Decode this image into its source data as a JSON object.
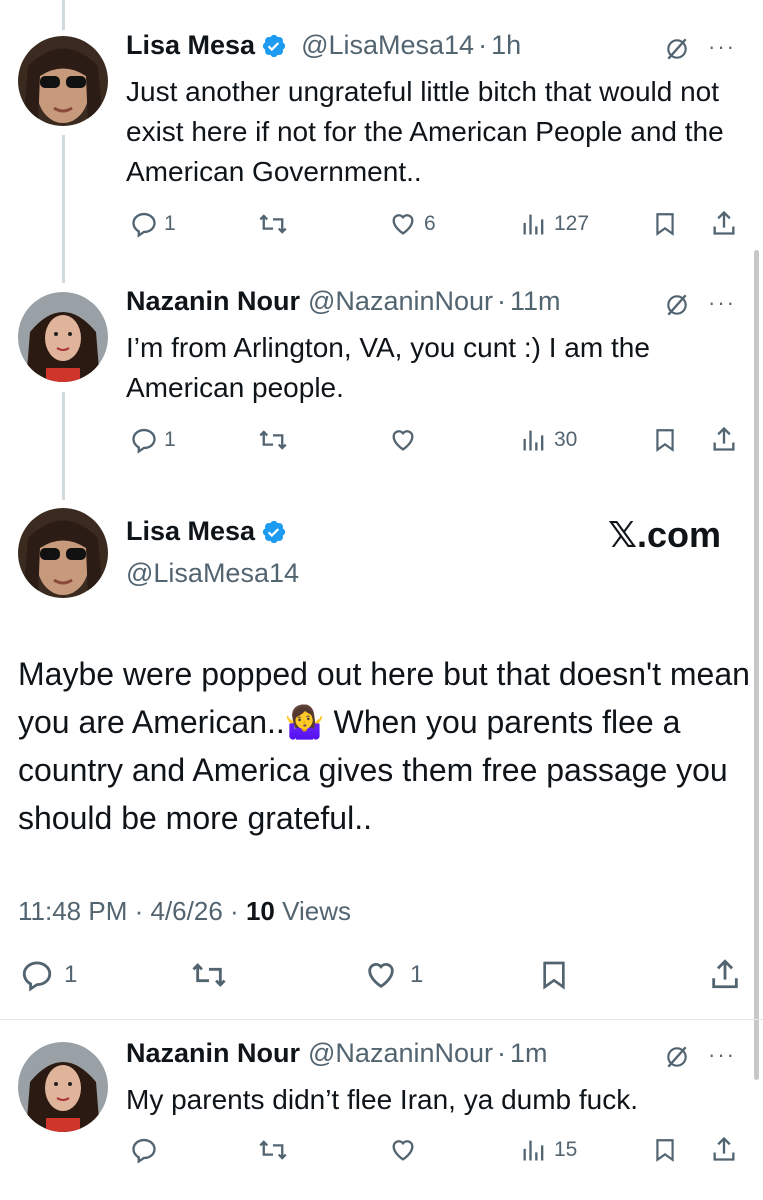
{
  "tweets": [
    {
      "name": "Lisa Mesa",
      "handle": "@LisaMesa14",
      "time": "1h",
      "text": "Just another ungrateful little bitch that would not exist here if not for the American People and the American Government..",
      "replies": "1",
      "likes": "6",
      "views": "127",
      "verified": true
    },
    {
      "name": "Nazanin Nour",
      "handle": "@NazaninNour",
      "time": "11m",
      "text": "I’m from Arlington, VA, you cunt :) I am the American people.",
      "replies": "1",
      "likes": "",
      "views": "30",
      "verified": false
    }
  ],
  "main_tweet": {
    "name": "Lisa Mesa",
    "handle": "@LisaMesa14",
    "watermark": "𝕏.com",
    "text": "Maybe were popped out here but that doesn't mean you are American..🤷‍♀️ When you parents flee a country and America gives them free passage you should be more grateful..",
    "time": "11:48 PM",
    "date": "4/6/26",
    "views_count": "10",
    "views_label": "Views",
    "replies": "1",
    "likes": "1"
  },
  "reply": {
    "name": "Nazanin Nour",
    "handle": "@NazaninNour",
    "time": "1m",
    "text": "My parents didn’t flee Iran, ya dumb fuck.",
    "views": "15"
  },
  "separator": "·",
  "more": "···",
  "colors": {
    "verified": "#1d9bf0",
    "secondary": "#536471",
    "line": "#cfd9de"
  }
}
